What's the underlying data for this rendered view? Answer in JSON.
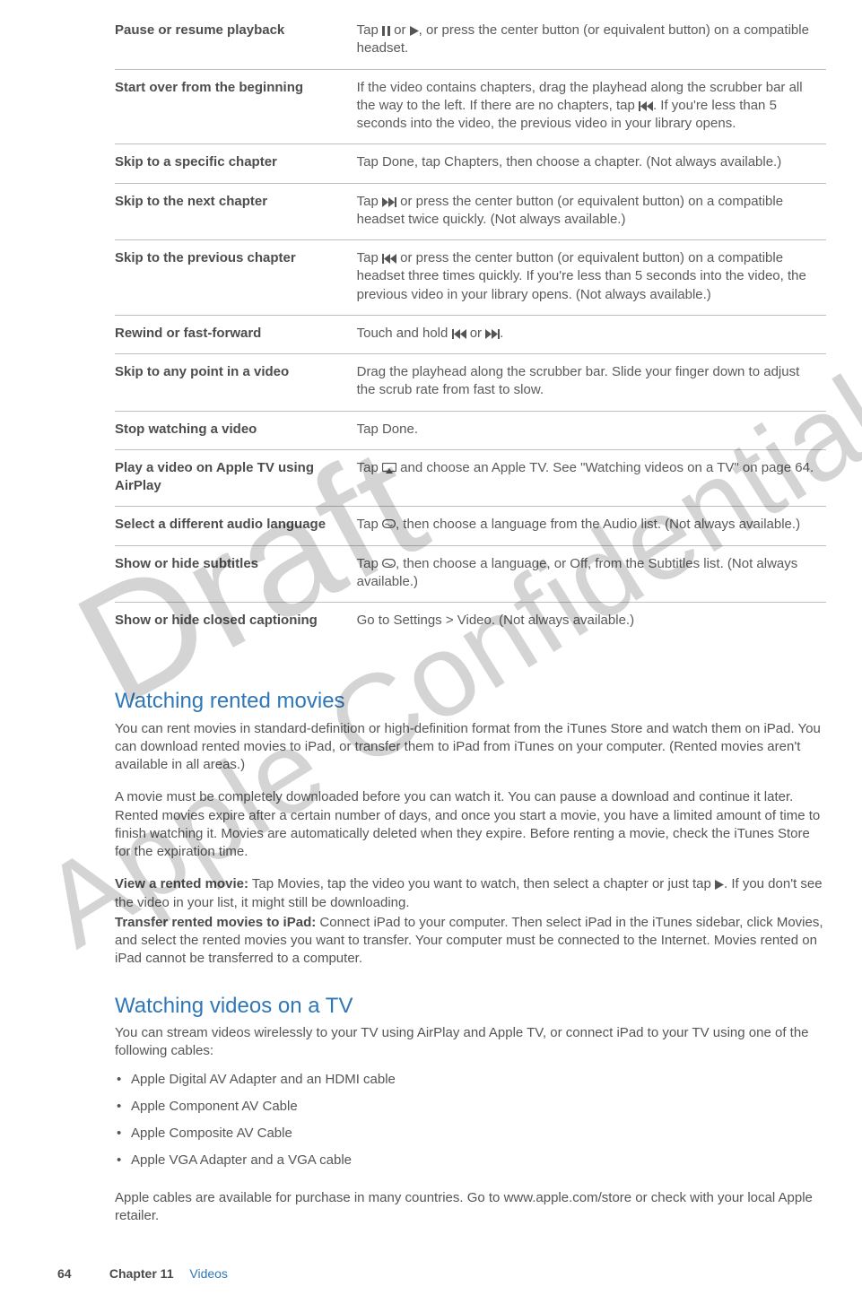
{
  "watermarks": {
    "draft": "Draft",
    "confidential": "Apple Confidential"
  },
  "icons": {
    "pause": "pause-icon",
    "play": "play-icon",
    "skip_back": "skip-back-icon",
    "skip_fwd": "skip-forward-icon",
    "airplay": "airplay-icon",
    "audio_lang": "audio-language-icon"
  },
  "table": {
    "rows": [
      {
        "label": "Pause or resume playback",
        "desc_parts": [
          "Tap ",
          "{pause}",
          " or ",
          "{play}",
          ", or press the center button (or equivalent button) on a compatible headset."
        ]
      },
      {
        "label": "Start over from the beginning",
        "desc_parts": [
          "If the video contains chapters, drag the playhead along the scrubber bar all the way to the left. If there are no chapters, tap ",
          "{skip_back}",
          ". If you're less than 5 seconds into the video, the previous video in your library opens."
        ]
      },
      {
        "label": "Skip to a specific chapter",
        "desc_parts": [
          "Tap Done, tap Chapters, then choose a chapter. (Not always available.)"
        ]
      },
      {
        "label": "Skip to the next chapter",
        "desc_parts": [
          "Tap ",
          "{skip_fwd}",
          " or press the center button (or equivalent button) on a compatible headset twice quickly. (Not always available.)"
        ]
      },
      {
        "label": "Skip to the previous chapter",
        "desc_parts": [
          "Tap ",
          "{skip_back}",
          " or press the center button (or equivalent button) on a compatible headset three times quickly. If you're less than 5 seconds into the video, the previous video in your library opens. (Not always available.)"
        ]
      },
      {
        "label": "Rewind or fast-forward",
        "desc_parts": [
          "Touch and hold ",
          "{skip_back}",
          " or ",
          "{skip_fwd}",
          "."
        ]
      },
      {
        "label": "Skip to any point in a video",
        "desc_parts": [
          "Drag the playhead along the scrubber bar. Slide your finger down to adjust the scrub rate from fast to slow."
        ]
      },
      {
        "label": "Stop watching a video",
        "desc_parts": [
          "Tap Done."
        ]
      },
      {
        "label": "Play a video on Apple TV using AirPlay",
        "desc_parts": [
          "Tap ",
          "{airplay}",
          " and choose an Apple TV. See \"Watching videos on a TV\" on page 64."
        ]
      },
      {
        "label": "Select a different audio language",
        "desc_parts": [
          "Tap ",
          "{audio_lang}",
          ", then choose a language from the Audio list. (Not always available.)"
        ]
      },
      {
        "label": "Show or hide subtitles",
        "desc_parts": [
          "Tap ",
          "{audio_lang}",
          ", then choose a language, or Off, from the Subtitles list. (Not always available.)"
        ]
      },
      {
        "label": "Show or hide closed captioning",
        "desc_parts": [
          "Go to Settings > Video. (Not always available.)"
        ]
      }
    ]
  },
  "sections": {
    "rented": {
      "heading": "Watching rented movies",
      "p1": "You can rent movies in standard-definition or high-definition format from the iTunes Store and watch them on iPad. You can download rented movies to iPad, or transfer them to iPad from iTunes on your computer. (Rented movies aren't available in all areas.)",
      "p2": "A movie must be completely downloaded before you can watch it. You can pause a download and continue it later. Rented movies expire after a certain number of days, and once you start a movie, you have a limited amount of time to finish watching it. Movies are automatically deleted when they expire. Before renting a movie, check the iTunes Store for the expiration time.",
      "view_label": "View a rented movie:",
      "view_text_pre": "  Tap Movies, tap the video you want to watch, then select a chapter or just tap ",
      "view_text_post": ". If you don't see the video in your list, it might still be downloading.",
      "transfer_label": "Transfer rented movies to iPad:",
      "transfer_text": "  Connect iPad to your computer. Then select iPad in the iTunes sidebar, click Movies, and select the rented movies you want to transfer. Your computer must be connected to the Internet. Movies rented on iPad cannot be transferred to a computer."
    },
    "tv": {
      "heading": "Watching videos on a TV",
      "intro": "You can stream videos wirelessly to your TV using AirPlay and Apple TV, or connect iPad to your TV using one of the following cables:",
      "bullets": [
        "Apple Digital AV Adapter and an HDMI cable",
        "Apple Component AV Cable",
        "Apple Composite AV Cable",
        "Apple VGA Adapter and a VGA cable"
      ],
      "outro": "Apple cables are available for purchase in many countries. Go to www.apple.com/store or check with your local Apple retailer."
    }
  },
  "footer": {
    "page": "64",
    "chapter_label": "Chapter 11",
    "chapter_title": "Videos"
  }
}
